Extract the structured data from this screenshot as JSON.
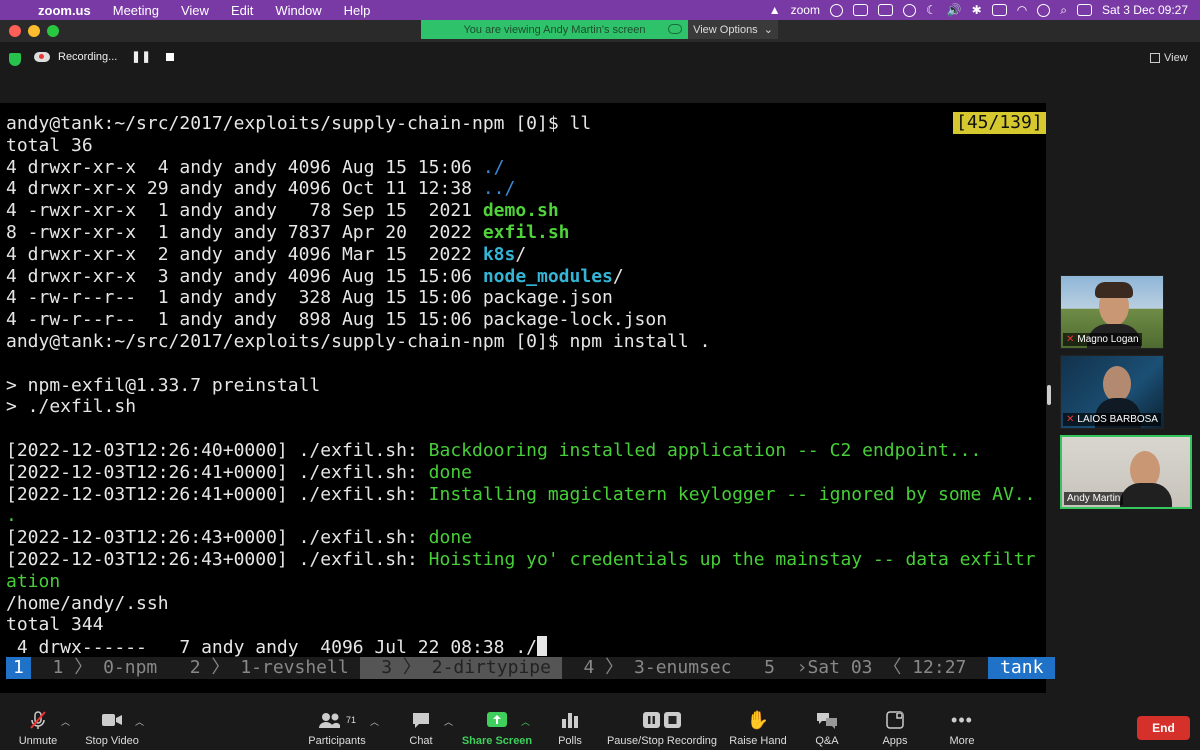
{
  "menubar": {
    "app": "zoom.us",
    "items": [
      "Meeting",
      "View",
      "Edit",
      "Window",
      "Help"
    ],
    "status_label": "zoom",
    "datetime": "Sat 3 Dec  09:27"
  },
  "banner": {
    "viewing_text": "You are viewing Andy Martin's screen",
    "view_options": "View Options"
  },
  "recording": {
    "label": "Recording..."
  },
  "view_button": "View",
  "terminal": {
    "counter": "[45/139]",
    "lines": [
      [
        {
          "t": "andy@tank:~/src/2017/exploits/supply-chain-npm [0]$ ll",
          "c": "white"
        }
      ],
      [
        {
          "t": "total 36",
          "c": "white"
        }
      ],
      [
        {
          "t": "4 drwxr-xr-x  4 andy andy 4096 Aug 15 15:06 ",
          "c": "white"
        },
        {
          "t": "./",
          "c": "blue"
        }
      ],
      [
        {
          "t": "4 drwxr-xr-x 29 andy andy 4096 Oct 11 12:38 ",
          "c": "white"
        },
        {
          "t": "../",
          "c": "blue"
        }
      ],
      [
        {
          "t": "4 -rwxr-xr-x  1 andy andy   78 Sep 15  2021 ",
          "c": "white"
        },
        {
          "t": "demo.sh",
          "c": "green"
        }
      ],
      [
        {
          "t": "8 -rwxr-xr-x  1 andy andy 7837 Apr 20  2022 ",
          "c": "white"
        },
        {
          "t": "exfil.sh",
          "c": "green"
        }
      ],
      [
        {
          "t": "4 drwxr-xr-x  2 andy andy 4096 Mar 15  2022 ",
          "c": "white"
        },
        {
          "t": "k8s",
          "c": "cyan"
        },
        {
          "t": "/",
          "c": "white"
        }
      ],
      [
        {
          "t": "4 drwxr-xr-x  3 andy andy 4096 Aug 15 15:06 ",
          "c": "white"
        },
        {
          "t": "node_modules",
          "c": "cyan"
        },
        {
          "t": "/",
          "c": "white"
        }
      ],
      [
        {
          "t": "4 -rw-r--r--  1 andy andy  328 Aug 15 15:06 package.json",
          "c": "white"
        }
      ],
      [
        {
          "t": "4 -rw-r--r--  1 andy andy  898 Aug 15 15:06 package-lock.json",
          "c": "white"
        }
      ],
      [
        {
          "t": "andy@tank:~/src/2017/exploits/supply-chain-npm [0]$ npm install .",
          "c": "white"
        }
      ],
      [
        {
          "t": "",
          "c": "white"
        }
      ],
      [
        {
          "t": "> npm-exfil@1.33.7 preinstall",
          "c": "white"
        }
      ],
      [
        {
          "t": "> ./exfil.sh",
          "c": "white"
        }
      ],
      [
        {
          "t": "",
          "c": "white"
        }
      ],
      [
        {
          "t": "[2022-12-03T12:26:40+0000] ./exfil.sh: ",
          "c": "white"
        },
        {
          "t": "Backdooring installed application -- C2 endpoint...",
          "c": "gtext"
        }
      ],
      [
        {
          "t": "[2022-12-03T12:26:41+0000] ./exfil.sh: ",
          "c": "white"
        },
        {
          "t": "done",
          "c": "gtext"
        }
      ],
      [
        {
          "t": "[2022-12-03T12:26:41+0000] ./exfil.sh: ",
          "c": "white"
        },
        {
          "t": "Installing magiclatern keylogger -- ignored by some AV..",
          "c": "gtext"
        }
      ],
      [
        {
          "t": ".",
          "c": "gtext"
        }
      ],
      [
        {
          "t": "[2022-12-03T12:26:43+0000] ./exfil.sh: ",
          "c": "white"
        },
        {
          "t": "done",
          "c": "gtext"
        }
      ],
      [
        {
          "t": "[2022-12-03T12:26:43+0000] ./exfil.sh: ",
          "c": "white"
        },
        {
          "t": "Hoisting yo' credentials up the mainstay -- data exfiltr",
          "c": "gtext"
        }
      ],
      [
        {
          "t": "ation",
          "c": "gtext"
        }
      ],
      [
        {
          "t": "/home/andy/.ssh",
          "c": "white"
        }
      ],
      [
        {
          "t": "total 344",
          "c": "white"
        }
      ],
      [
        {
          "t": " 4 drwx------   7 andy andy  4096 Jul 22 08:38 ./",
          "c": "white"
        }
      ]
    ]
  },
  "tmux": {
    "current": "1",
    "windows": [
      {
        "idx": "1",
        "name": "0-npm"
      },
      {
        "idx": "2",
        "name": "1-revshell"
      },
      {
        "idx": "3",
        "name": "2-dirtypipe"
      },
      {
        "idx": "4",
        "name": "3-enumsec"
      },
      {
        "idx": "5",
        "name": ""
      }
    ],
    "date": "Sat 03",
    "time": "12:27",
    "host": "tank"
  },
  "participants": [
    {
      "name": "Magno Logan"
    },
    {
      "name": "LAIOS BARBOSA"
    },
    {
      "name": "Andy Martin"
    }
  ],
  "controls": {
    "unmute": "Unmute",
    "stop_video": "Stop Video",
    "participants": "Participants",
    "participants_count": "71",
    "chat": "Chat",
    "share_screen": "Share Screen",
    "polls": "Polls",
    "pause_stop_recording": "Pause/Stop Recording",
    "raise_hand": "Raise Hand",
    "qa": "Q&A",
    "apps": "Apps",
    "more": "More",
    "end": "End"
  },
  "colors": {
    "menubar": "#7a3aa6",
    "banner": "#2ec36a",
    "end": "#d6302a",
    "tmux_accent": "#1f72c8"
  }
}
